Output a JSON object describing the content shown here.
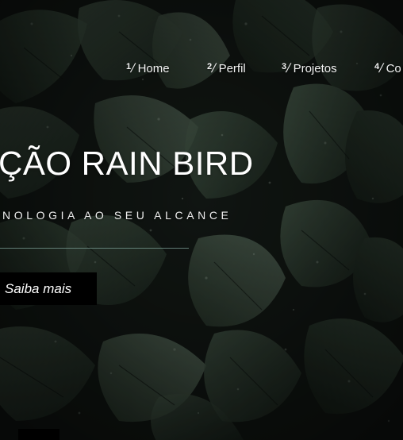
{
  "nav": {
    "items": [
      {
        "number": "1",
        "label": "Home"
      },
      {
        "number": "2",
        "label": "Perfil"
      },
      {
        "number": "3",
        "label": "Projetos"
      },
      {
        "number": "4",
        "label": "Co"
      }
    ]
  },
  "hero": {
    "title": "ÇÃO RAIN BIRD",
    "subtitle": "NOLOGIA AO SEU ALCANCE",
    "cta_label": "Saiba mais"
  },
  "colors": {
    "background": "#141a16",
    "leaf_dark": "#1f2b22",
    "leaf_mid": "#2d3d30",
    "leaf_light": "#4a5e4a",
    "text": "#ffffff",
    "button": "#000000",
    "divider": "#6e8f86"
  }
}
